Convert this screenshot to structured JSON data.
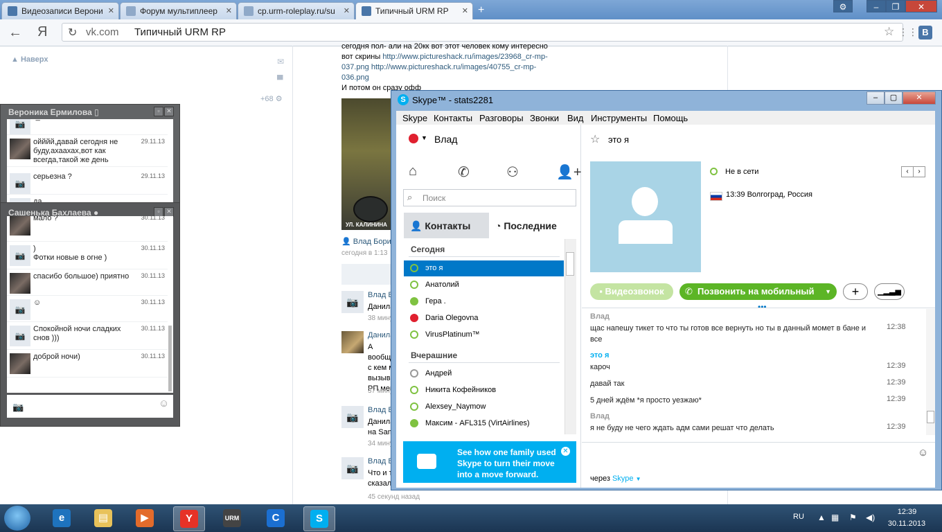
{
  "browser": {
    "tabs": [
      {
        "label": "Видеозаписи Верони",
        "active": false,
        "icon_color": "#4a76a8"
      },
      {
        "label": "Форум мультиплеер",
        "active": false,
        "icon_color": "#8fa9c8"
      },
      {
        "label": "cp.urm-roleplay.ru/su",
        "active": false,
        "icon_color": "#8fa9c8"
      },
      {
        "label": "Типичный URM RP",
        "active": true,
        "icon_color": "#4a76a8"
      }
    ],
    "new_tab": "+",
    "address_domain": "vk.com",
    "address_title": "Типичный URM RP",
    "yandex_button": "Я",
    "vk_button": "В"
  },
  "vk": {
    "back_to_top": "Наверх",
    "counter": "+68",
    "post_text": [
      "сегодня пол- али на 20кк вот этот человек кому интересно",
      "вот скрины"
    ],
    "post_link1": "http://www.pictureshack.ru/images/23968_cr-mp-037.png",
    "post_link2": "http://www.pictureshack.ru/images/40755_cr-mp-036.png",
    "post_after": "И потом он сразу офф",
    "screenshot_caption": "УЛ. КАЛИНИНА",
    "post_author": "Влад Борис",
    "post_time": "сегодня в 1:13",
    "comments": [
      {
        "name": "Влад Б",
        "text": "Данила",
        "time": "38 мину"
      },
      {
        "name": "Данила",
        "text": "А вообщ с кем м вызыв РП мен",
        "time": "37 мину"
      },
      {
        "name": "Влад Б",
        "text": "Данила на Sam",
        "time": "34 мину"
      },
      {
        "name": "Влад Б",
        "text": "Что и т сказал",
        "time": "45 секунд назад"
      }
    ]
  },
  "chat1": {
    "title": "Вероника Ермилова",
    "messages": [
      {
        "text": "-_",
        "date": ""
      },
      {
        "text": "ойййй,давай сегодня не буду,ахаахах,вот как всегда,такой же день",
        "date": "29.11.13"
      },
      {
        "text": "серьезна ?",
        "date": "29.11.13"
      },
      {
        "text": "да",
        "date": ""
      }
    ]
  },
  "chat2": {
    "title": "Сашенька Бахлаева",
    "messages": [
      {
        "text": "мало ?",
        "date": "30.11.13",
        "photo": true
      },
      {
        "text": ")\nФотки новые в огне )",
        "date": "30.11.13",
        "photo": false
      },
      {
        "text": "спасибо большое) приятно",
        "date": "30.11.13",
        "photo": true
      },
      {
        "text": "☺",
        "date": "30.11.13",
        "photo": false
      },
      {
        "text": "Спокойной ночи сладких снов )))",
        "date": "30.11.13",
        "photo": false
      },
      {
        "text": "доброй ночи)",
        "date": "30.11.13",
        "photo": true
      }
    ]
  },
  "skype": {
    "title": "Skype™ - stats2281",
    "menu": [
      "Skype",
      "Контакты",
      "Разговоры",
      "Звонки",
      "Вид",
      "Инструменты",
      "Помощь"
    ],
    "user": "Влад",
    "search_placeholder": "Поиск",
    "tab_contacts": "Контакты",
    "tab_recent": "Последние",
    "group_today": "Сегодня",
    "today": [
      {
        "name": "это я",
        "status": "offline",
        "selected": true
      },
      {
        "name": "Анатолий",
        "status": "offline",
        "selected": false
      },
      {
        "name": "Гера .",
        "status": "online",
        "selected": false
      },
      {
        "name": "Daria Olegovna",
        "status": "busy",
        "selected": false
      },
      {
        "name": "VirusPlatinum™",
        "status": "fwd",
        "selected": false
      }
    ],
    "group_yesterday": "Вчерашние",
    "yesterday": [
      {
        "name": "Андрей",
        "status": "unknown"
      },
      {
        "name": "Никита Кофейников",
        "status": "offline"
      },
      {
        "name": "Alexsey_Naymow",
        "status": "offline"
      },
      {
        "name": "Максим - AFL315 (VirtAirlines)",
        "status": "online"
      }
    ],
    "ad_text": "See how one family used Skype to turn their move into a move forward.",
    "contact_name": "это я",
    "presence": "Не в сети",
    "location": "13:39 Волгоград, Россия",
    "video_button": "Видеозвонок",
    "call_mobile": "Позвонить на мобильный",
    "chat": [
      {
        "name": "Влад",
        "me": false,
        "lines": [
          {
            "text": "щас напешу тикет то что ты готов все вернуть но ты в данный момет в бане и все",
            "time": "12:38"
          }
        ]
      },
      {
        "name": "это я",
        "me": true,
        "lines": [
          {
            "text": "кароч",
            "time": "12:39"
          },
          {
            "text": "давай так",
            "time": "12:39"
          },
          {
            "text": "5 дней ждём *я просто уезжаю*",
            "time": "12:39"
          }
        ]
      },
      {
        "name": "Влад",
        "me": false,
        "lines": [
          {
            "text": "я не буду не чего ждать адм сами решат что делать",
            "time": "12:39"
          }
        ]
      }
    ],
    "via_label": "через",
    "via_link": "Skype",
    "colors": {
      "accent": "#00aff0",
      "call_green": "#5cb526",
      "selected": "#0078c8"
    }
  },
  "taskbar": {
    "lang": "RU",
    "time": "12:39",
    "date": "30.11.2013",
    "apps": [
      {
        "name": "ie-icon",
        "label": "e",
        "color": "#1e73be",
        "active": false
      },
      {
        "name": "explorer-icon",
        "label": "▤",
        "color": "#e8c25a",
        "active": false
      },
      {
        "name": "media-player-icon",
        "label": "▶",
        "color": "#e36b2b",
        "active": false
      },
      {
        "name": "yandex-browser-icon",
        "label": "Y",
        "color": "#e63227",
        "active": true
      },
      {
        "name": "urm-rp-icon",
        "label": "URM",
        "color": "#444",
        "active": false
      },
      {
        "name": "cr-mp-icon",
        "label": "C",
        "color": "#1b6fd1",
        "active": false
      },
      {
        "name": "skype-icon",
        "label": "S",
        "color": "#00aff0",
        "active": true
      }
    ]
  }
}
